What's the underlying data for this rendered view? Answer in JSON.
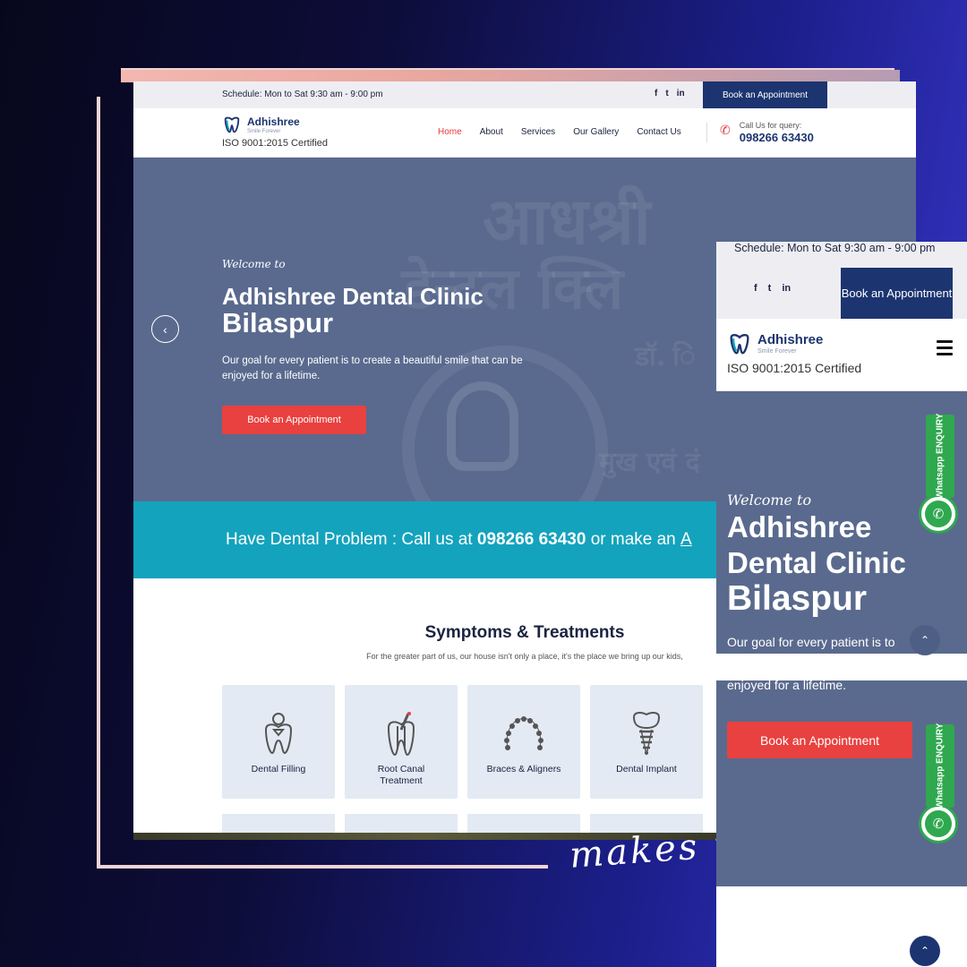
{
  "overlay_text": "makes my",
  "desktop": {
    "topbar": {
      "schedule": "Schedule: Mon to Sat 9:30 am - 9:00 pm",
      "socials": [
        "f",
        "t",
        "in"
      ],
      "book_label": "Book an Appointment"
    },
    "header": {
      "brand": "Adhishree",
      "tagline": "Smile Forever",
      "certification": "ISO 9001:2015 Certified",
      "nav": [
        "Home",
        "About",
        "Services",
        "Our Gallery",
        "Contact Us"
      ],
      "active_nav": "Home",
      "call_label": "Call Us for query:",
      "phone": "098266 63430"
    },
    "hero": {
      "welcome": "Welcome to",
      "title_line1": "Adhishree Dental Clinic",
      "title_line2": "Bilaspur",
      "description": "Our goal for every patient is to create a beautiful smile that can be enjoyed for a lifetime.",
      "cta": "Book an Appointment",
      "bg_text_line1": "आधश्री",
      "bg_text_line2": "डेन्टल  क्लि",
      "bg_text_line3": "डॉ. ि",
      "bg_text_line4": "मुख एवं दं"
    },
    "banner": {
      "prefix": "Have Dental Problem : Call us at ",
      "phone": "098266 63430",
      "suffix": " or make an ",
      "link": "A"
    },
    "symptoms": {
      "title": "Symptoms & Treatments",
      "subtitle": "For the greater part of us, our house isn't only a place, it's the place we bring up our kids,",
      "cards": [
        {
          "label": "Dental Filling",
          "icon": "dental-filling-icon"
        },
        {
          "label": "Root Canal Treatment",
          "icon": "root-canal-icon"
        },
        {
          "label": "Braces & Aligners",
          "icon": "braces-icon"
        },
        {
          "label": "Dental Implant",
          "icon": "implant-icon"
        }
      ]
    }
  },
  "mobile": {
    "schedule": "Schedule: Mon to Sat 9:30 am - 9:00 pm",
    "socials": [
      "f",
      "t",
      "in"
    ],
    "book_label": "Book an Appointment",
    "brand": "Adhishree",
    "tagline": "Smile Forever",
    "certification": "ISO 9001:2015 Certified",
    "welcome": "Welcome to",
    "title_line1": "Adhishree Dental Clinic",
    "title_line2": "Bilaspur",
    "desc_part1": "Our goal for every patient is to",
    "desc_part2": "enjoyed for a lifetime.",
    "cta": "Book an Appointment",
    "whatsapp_label": "Whatsapp ENQUIRY"
  },
  "colors": {
    "navy": "#1c3470",
    "accent_red": "#e8413f",
    "banner_teal": "#13a3bd",
    "hero_bg": "#5a6a8e",
    "whatsapp_green": "#2fa84f"
  }
}
